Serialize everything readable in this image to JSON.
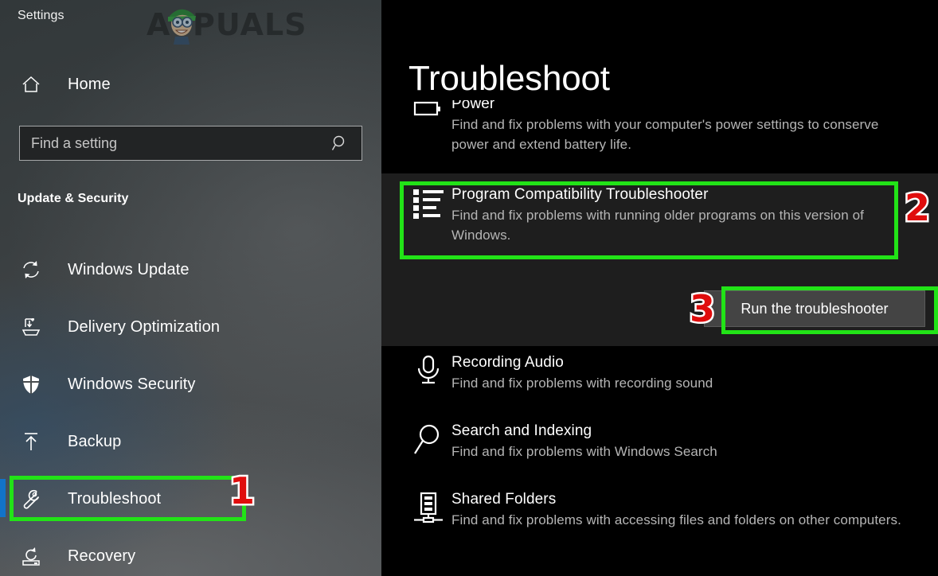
{
  "window": {
    "title": "Settings",
    "watermark": "APPUALS"
  },
  "sidebar": {
    "home": {
      "label": "Home",
      "icon": "home-icon"
    },
    "search": {
      "placeholder": "Find a setting",
      "value": "",
      "icon": "search-icon"
    },
    "group_header": "Update & Security",
    "items": [
      {
        "label": "Windows Update",
        "icon": "refresh-icon",
        "selected": false
      },
      {
        "label": "Delivery Optimization",
        "icon": "delivery-icon",
        "selected": false
      },
      {
        "label": "Windows Security",
        "icon": "shield-icon",
        "selected": false
      },
      {
        "label": "Backup",
        "icon": "upload-arrow-icon",
        "selected": false
      },
      {
        "label": "Troubleshoot",
        "icon": "wrench-icon",
        "selected": true
      },
      {
        "label": "Recovery",
        "icon": "recovery-icon",
        "selected": false
      }
    ]
  },
  "main": {
    "title": "Troubleshoot",
    "items": [
      {
        "name": "Power",
        "desc": "Find and fix problems with your computer's power settings to conserve power and extend battery life.",
        "icon": "battery-icon",
        "selected": false
      },
      {
        "name": "Program Compatibility Troubleshooter",
        "desc": "Find and fix problems with running older programs on this version of Windows.",
        "icon": "list-icon",
        "selected": true,
        "action_button": "Run the troubleshooter"
      },
      {
        "name": "Recording Audio",
        "desc": "Find and fix problems with recording sound",
        "icon": "microphone-icon",
        "selected": false
      },
      {
        "name": "Search and Indexing",
        "desc": "Find and fix problems with Windows Search",
        "icon": "magnifier-icon",
        "selected": false
      },
      {
        "name": "Shared Folders",
        "desc": "Find and fix problems with accessing files and folders on other computers.",
        "icon": "server-network-icon",
        "selected": false
      }
    ]
  },
  "annotations": {
    "badges": [
      "1",
      "2",
      "3"
    ],
    "highlight_color": "#22e317",
    "badge_color": "#e00d0d",
    "selection_bar_color": "#1273c9"
  }
}
